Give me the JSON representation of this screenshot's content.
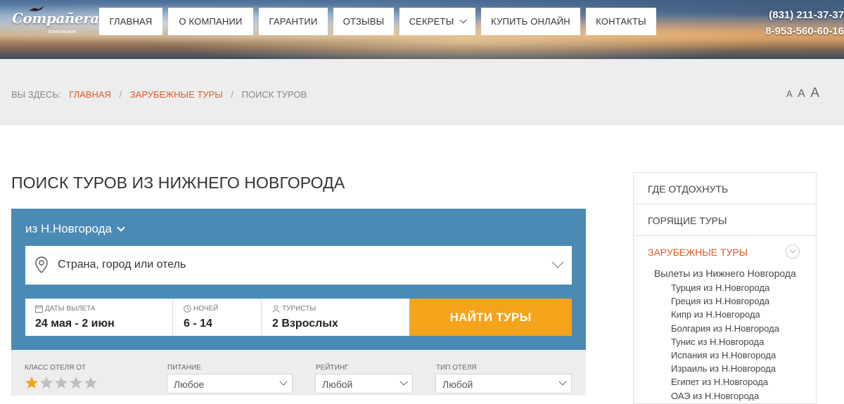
{
  "header": {
    "logo_text": "Compañera",
    "logo_sub": "компаньера",
    "nav": [
      {
        "label": "Главная",
        "has_dropdown": false
      },
      {
        "label": "О компании",
        "has_dropdown": false
      },
      {
        "label": "Гарантии",
        "has_dropdown": false
      },
      {
        "label": "Отзывы",
        "has_dropdown": false
      },
      {
        "label": "Секреты",
        "has_dropdown": true
      },
      {
        "label": "Купить онлайн",
        "has_dropdown": false
      },
      {
        "label": "Контакты",
        "has_dropdown": false
      }
    ],
    "phone1": "(831) 211-37-37",
    "phone2": "8-953-560-60-16"
  },
  "breadcrumb": {
    "label": "Вы здесь:",
    "items": [
      "Главная",
      "Зарубежные туры"
    ],
    "current": "Поиск туров"
  },
  "font_size_control": [
    "A",
    "A",
    "A"
  ],
  "page_title": "Поиск туров из Нижнего Новгорода",
  "search": {
    "departure": "из Н.Новгорода",
    "destination_placeholder": "Страна, город или отель",
    "dates_label": "Даты вылета",
    "dates_value": "24 мая - 2 июн",
    "nights_label": "Ночей",
    "nights_value": "6 - 14",
    "tourists_label": "Туристы",
    "tourists_value": "2 Взрослых",
    "find_button": "Найти туры"
  },
  "filters": {
    "hotel_class_label": "Класс отеля от",
    "hotel_class_stars": 1,
    "hotel_class_max": 5,
    "meal_label": "Питание",
    "meal_value": "Любое",
    "rating_label": "Рейтинг",
    "rating_value": "Любой",
    "hotel_type_label": "Тип отеля",
    "hotel_type_value": "Любой"
  },
  "sidebar": {
    "items": [
      "Где отдохнуть",
      "Горящие туры",
      "Зарубежные туры"
    ],
    "active_index": 2,
    "sub_head": "Вылеты из Нижнего Новгорода",
    "sub_items": [
      "Турция из Н.Новгорода",
      "Греция из Н.Новгорода",
      "Кипр из Н.Новгорода",
      "Болгария из Н.Новгорода",
      "Тунис из Н.Новгорода",
      "Испания из Н.Новгорода",
      "Израиль из Н.Новгорода",
      "Египет из Н.Новгорода",
      "ОАЭ из Н.Новгорода"
    ]
  },
  "colors": {
    "accent": "#e0592a",
    "search_bg": "#4a8ab5",
    "button": "#f5a31a",
    "star_active": "#f5a31a",
    "star_inactive": "#bfbfbf"
  }
}
